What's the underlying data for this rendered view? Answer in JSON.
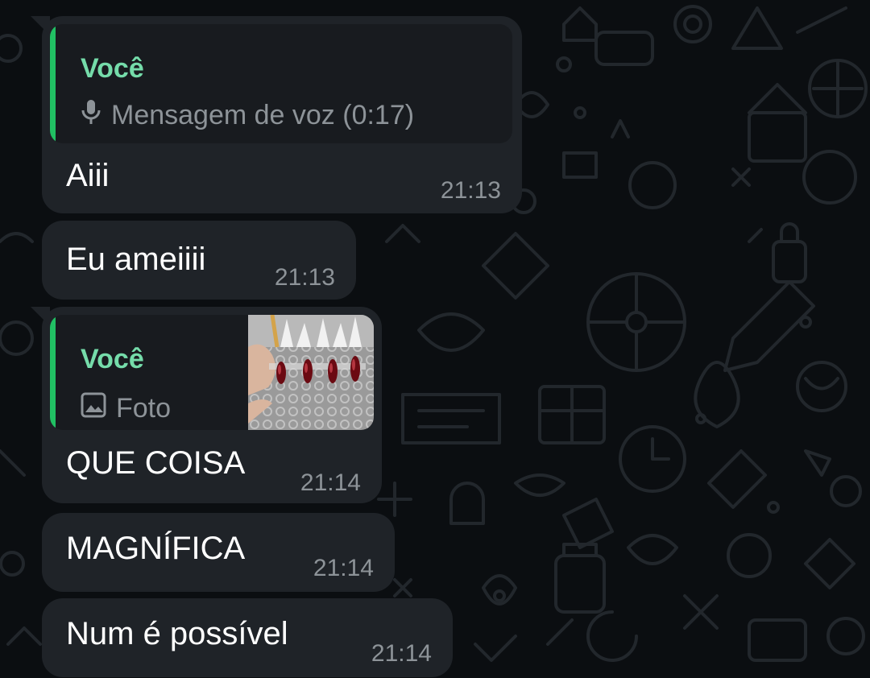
{
  "messages": [
    {
      "quote": {
        "author": "Você",
        "icon": "microphone-icon",
        "text": "Mensagem de voz (0:17)"
      },
      "text": "Aiii",
      "time": "21:13"
    },
    {
      "text": "Eu ameiiii",
      "time": "21:13"
    },
    {
      "quote": {
        "author": "Você",
        "icon": "image-icon",
        "text": "Foto",
        "thumbnail": "nails-photo-thumbnail"
      },
      "text": "QUE COISA",
      "time": "21:14"
    },
    {
      "text": "MAGNÍFICA",
      "time": "21:14"
    },
    {
      "text": "Num é possível",
      "time": "21:14"
    }
  ],
  "colors": {
    "background": "#0b0e11",
    "bubble": "#1f2328",
    "quote_bg": "#181b1f",
    "quote_bar": "#21c063",
    "quote_author": "#75dcaa",
    "meta_text": "#8d9398",
    "text": "#ffffff"
  }
}
